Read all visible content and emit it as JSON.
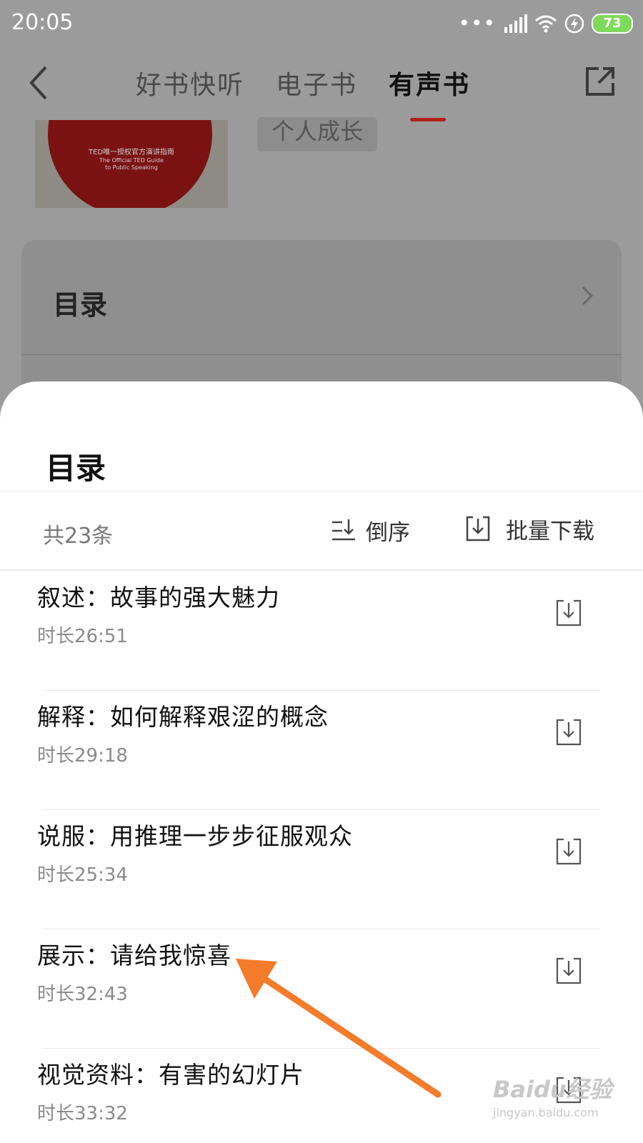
{
  "status_bar": {
    "time": "20:05",
    "dots": "•••",
    "battery": "73",
    "icons": [
      "signal-icon",
      "wifi-icon",
      "charging-icon",
      "battery-icon"
    ]
  },
  "nav": {
    "tabs": [
      "好书快听",
      "电子书",
      "有声书"
    ],
    "active_tab": "有声书",
    "accent_color": "#b1201b"
  },
  "book": {
    "cover_line1": "TED唯一授权官方演讲指南",
    "cover_line2": "The Official TED Guide",
    "cover_line3": "to Public Speaking",
    "tag": "个人成长"
  },
  "background_card": {
    "title": "目录"
  },
  "sheet": {
    "title": "目录",
    "count": "共23条",
    "sort_label": "倒序",
    "download_all_label": "批量下载",
    "items": [
      {
        "title": "叙述：故事的强大魅力",
        "duration": "时长26:51"
      },
      {
        "title": "解释：如何解释艰涩的概念",
        "duration": "时长29:18"
      },
      {
        "title": "说服：用推理一步步征服观众",
        "duration": "时长25:34"
      },
      {
        "title": "展示：请给我惊喜",
        "duration": "时长32:43"
      },
      {
        "title": "视觉资料：有害的幻灯片",
        "duration": "时长33:32"
      }
    ]
  },
  "annotation": {
    "arrow_color": "#f47b2a"
  },
  "watermark": {
    "main": "Baidu经验",
    "sub": "jingyan.baidu.com"
  }
}
